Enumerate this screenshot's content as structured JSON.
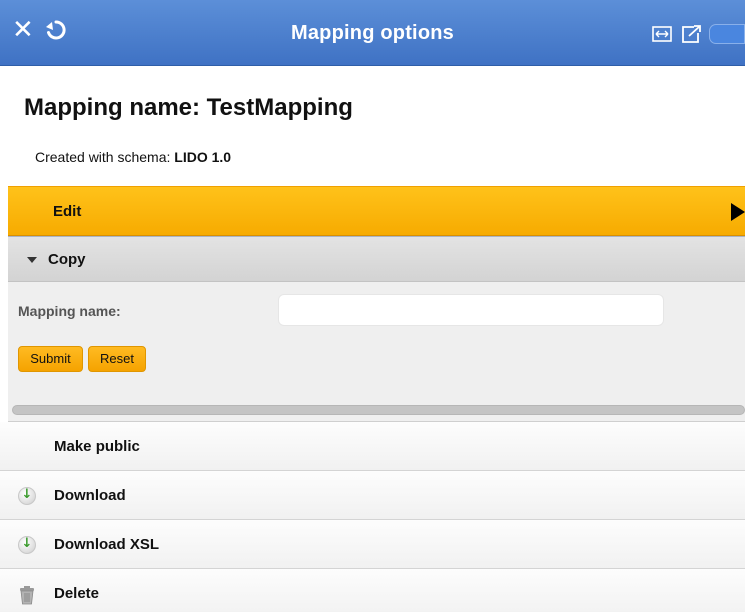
{
  "window": {
    "title": "Mapping options",
    "icons": [
      "close-icon",
      "refresh-icon",
      "expand-icon",
      "popout-icon"
    ]
  },
  "mapping": {
    "heading": "Mapping name: TestMapping",
    "schema_prefix": "Created with schema:",
    "schema_name": "LIDO 1.0"
  },
  "edit": {
    "label": "Edit"
  },
  "copy": {
    "label": "Copy",
    "field_label": "Mapping name:",
    "field_value": "",
    "field_placeholder": "",
    "submit_label": "Submit",
    "reset_label": "Reset"
  },
  "actions": {
    "make_public": "Make public",
    "download": "Download",
    "download_xsl": "Download XSL",
    "delete": "Delete"
  },
  "colors": {
    "titlebar": "#4b7fcf",
    "accent": "#ffb300",
    "copy_bg": "#efefef"
  }
}
